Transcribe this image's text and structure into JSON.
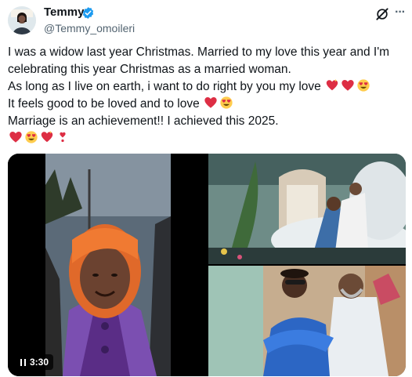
{
  "author": {
    "display_name": "Temmy",
    "handle": "@Temmy_omoileri",
    "verified": true,
    "verified_color": "#1d9bf0"
  },
  "actions": {
    "grok_icon": "grok-icon",
    "more_icon": "more-icon"
  },
  "tweet": {
    "lines": [
      "I was a widow last year Christmas. Married to my love this year and I'm",
      "celebrating this year Christmas as a  married woman.",
      "As long as I live on earth, i want to do right by you my love",
      "It feels good to be loved and to love",
      "Marriage is an achievement!! I achieved this 2025."
    ],
    "emojis": {
      "line3": [
        "heart-sparkle-emoji",
        "red-heart-emoji",
        "heart-eyes-emoji"
      ],
      "line4": [
        "red-heart-emoji",
        "heart-eyes-emoji"
      ],
      "line6": [
        "red-heart-emoji",
        "heart-eyes-emoji",
        "heart-sparkle-emoji",
        "heart-exclamation-emoji"
      ]
    }
  },
  "media": {
    "video_duration": "3:30",
    "items": [
      "video-selfie",
      "wedding-photo-dance",
      "wedding-photo-couple"
    ]
  }
}
